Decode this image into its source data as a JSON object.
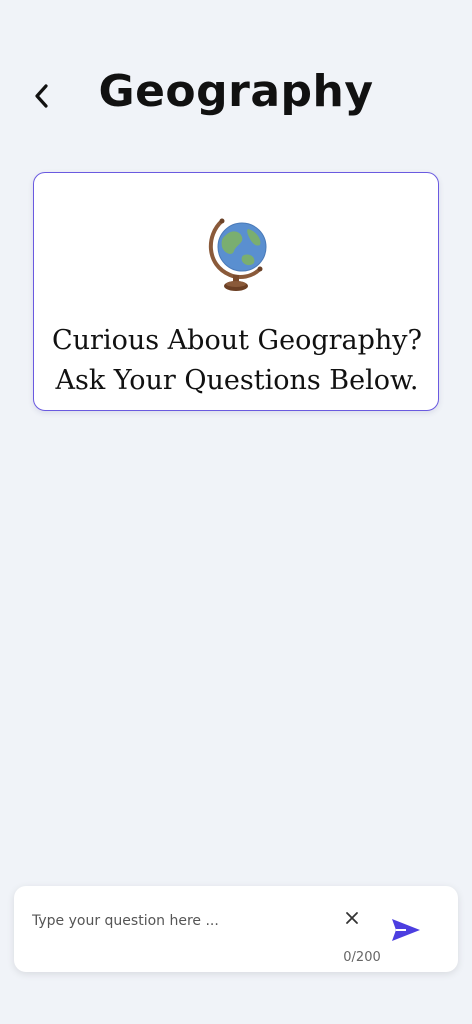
{
  "header": {
    "title": "Geography",
    "back_icon": "chevron-left-icon"
  },
  "intro": {
    "icon": "globe-icon",
    "line1": "Curious About Geography?",
    "line2": "Ask Your Questions Below."
  },
  "composer": {
    "placeholder": "Type your question here ...",
    "value": "",
    "char_count": "0/200",
    "clear_icon": "close-icon",
    "send_icon": "send-icon"
  },
  "colors": {
    "background": "#f0f3f8",
    "accent": "#4c3ee0",
    "card_border": "#6a5ae0",
    "text": "#111111"
  }
}
